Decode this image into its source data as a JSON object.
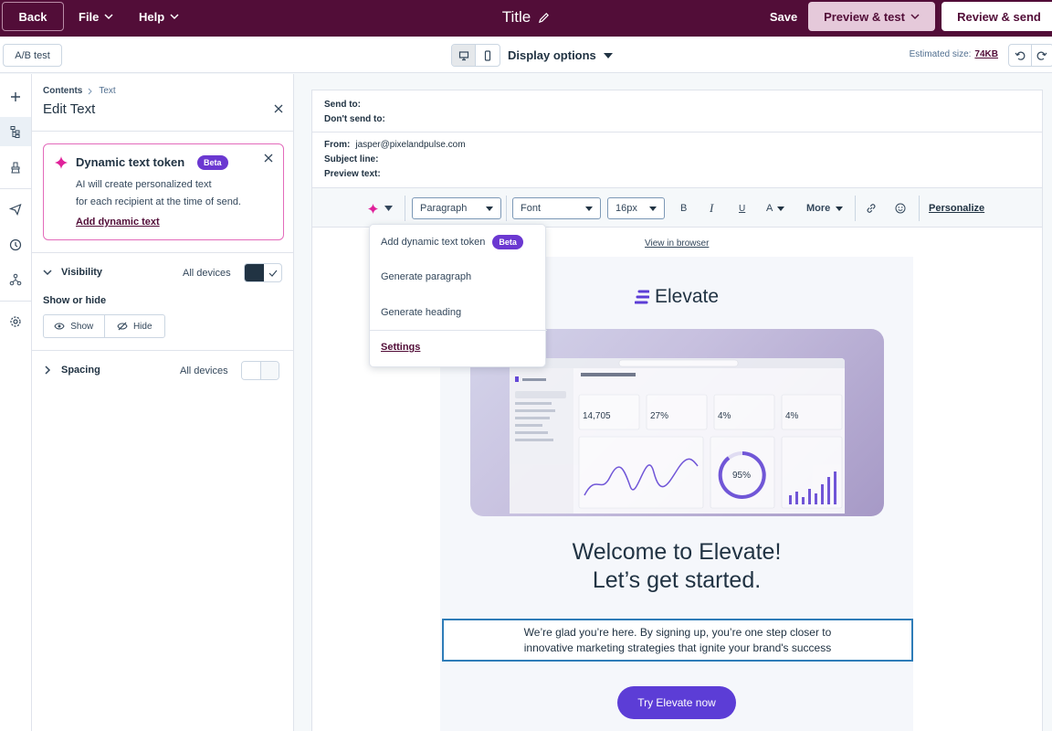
{
  "header": {
    "back_label": "Back",
    "file_label": "File",
    "help_label": "Help",
    "title": "Title",
    "save_label": "Save",
    "preview_label": "Preview & test",
    "review_label": "Review & send"
  },
  "subbar": {
    "ab_test_label": "A/B test",
    "display_options_label": "Display options",
    "estimated_size_label": "Estimated size:",
    "estimated_size_value": "74KB"
  },
  "panel": {
    "breadcrumb_root": "Contents",
    "breadcrumb_current": "Text",
    "title": "Edit Text",
    "dynamic_card": {
      "title": "Dynamic text token",
      "badge": "Beta",
      "description_line1": "AI will create personalized text",
      "description_line2": "for each recipient at the time of send.",
      "link": "Add dynamic text"
    },
    "visibility": {
      "label": "Visibility",
      "devices": "All devices",
      "show_or_hide_label": "Show or hide",
      "show_label": "Show",
      "hide_label": "Hide"
    },
    "spacing": {
      "label": "Spacing",
      "devices": "All devices"
    }
  },
  "editor": {
    "send_to_label": "Send to:",
    "dont_send_to_label": "Don't send to:",
    "from_label": "From:",
    "from_value": "jasper@pixelandpulse.com",
    "subject_label": "Subject line:",
    "preview_text_label": "Preview text:",
    "toolbar": {
      "paragraph": "Paragraph",
      "font": "Font",
      "size": "16px",
      "bold": "B",
      "italic": "I",
      "underline": "U",
      "text_color": "A",
      "more": "More",
      "personalize": "Personalize"
    },
    "ai_menu": {
      "item1": "Add dynamic text token",
      "item1_badge": "Beta",
      "item2": "Generate paragraph",
      "item3": "Generate heading",
      "settings": "Settings"
    },
    "view_in_browser": "View in browser",
    "email": {
      "logo_text": "Elevate",
      "headline_line1": "Welcome to Elevate!",
      "headline_line2": "Let’s get started.",
      "intro_line1": "We’re glad you’re here. By signing up, you’re one step closer to",
      "intro_line2": "innovative marketing strategies that ignite your brand's success",
      "cta": "Try Elevate now"
    }
  },
  "colors": {
    "brand_dark": "#520d38",
    "brand_light": "#e5c9da",
    "ai_pink": "#e0219a",
    "beta_purple": "#6b38d1",
    "cta_purple": "#5c3dd6",
    "selection_blue": "#2e7cb8"
  },
  "icons": {
    "title_edit": "pencil-icon",
    "ai_sparkle": "sparkle-icon",
    "desktop": "desktop-icon",
    "mobile": "mobile-icon",
    "undo": "undo-icon",
    "redo": "redo-icon"
  }
}
